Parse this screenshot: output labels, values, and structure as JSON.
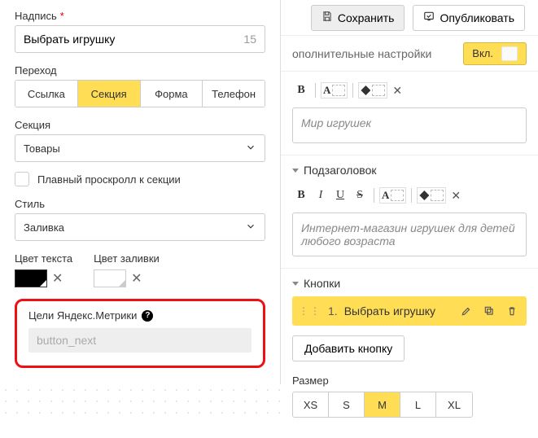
{
  "toolbar": {
    "save_label": "Сохранить",
    "publish_label": "Опубликовать"
  },
  "settings_bar": {
    "title": "ополнительные настройки",
    "toggle_label": "Вкл."
  },
  "left": {
    "caption": {
      "label": "Надпись",
      "value": "Выбрать игрушку",
      "count": "15"
    },
    "transition": {
      "label": "Переход",
      "tabs": [
        "Ссылка",
        "Секция",
        "Форма",
        "Телефон"
      ],
      "active_index": 1
    },
    "section": {
      "label": "Секция",
      "value": "Товары"
    },
    "smooth_scroll": {
      "label": "Плавный проскролл к секции",
      "checked": false
    },
    "style": {
      "label": "Стиль",
      "value": "Заливка"
    },
    "colors": {
      "text_label": "Цвет текста",
      "fill_label": "Цвет заливки",
      "text_color": "#000000",
      "fill_color": "#ffffff"
    },
    "goals": {
      "label": "Цели Яндекс.Метрики",
      "placeholder": "button_next"
    }
  },
  "editor1": {
    "placeholder": "Мир игрушек"
  },
  "sub_heading": {
    "title": "Подзаголовок"
  },
  "editor2": {
    "placeholder": "Интернет-магазин игрушек для детей любого возраста"
  },
  "buttons_section": {
    "title": "Кнопки",
    "items": [
      {
        "index": "1.",
        "name": "Выбрать игрушку"
      }
    ],
    "add_label": "Добавить кнопку"
  },
  "size": {
    "label": "Размер",
    "options": [
      "XS",
      "S",
      "M",
      "L",
      "XL"
    ],
    "active_index": 2
  }
}
